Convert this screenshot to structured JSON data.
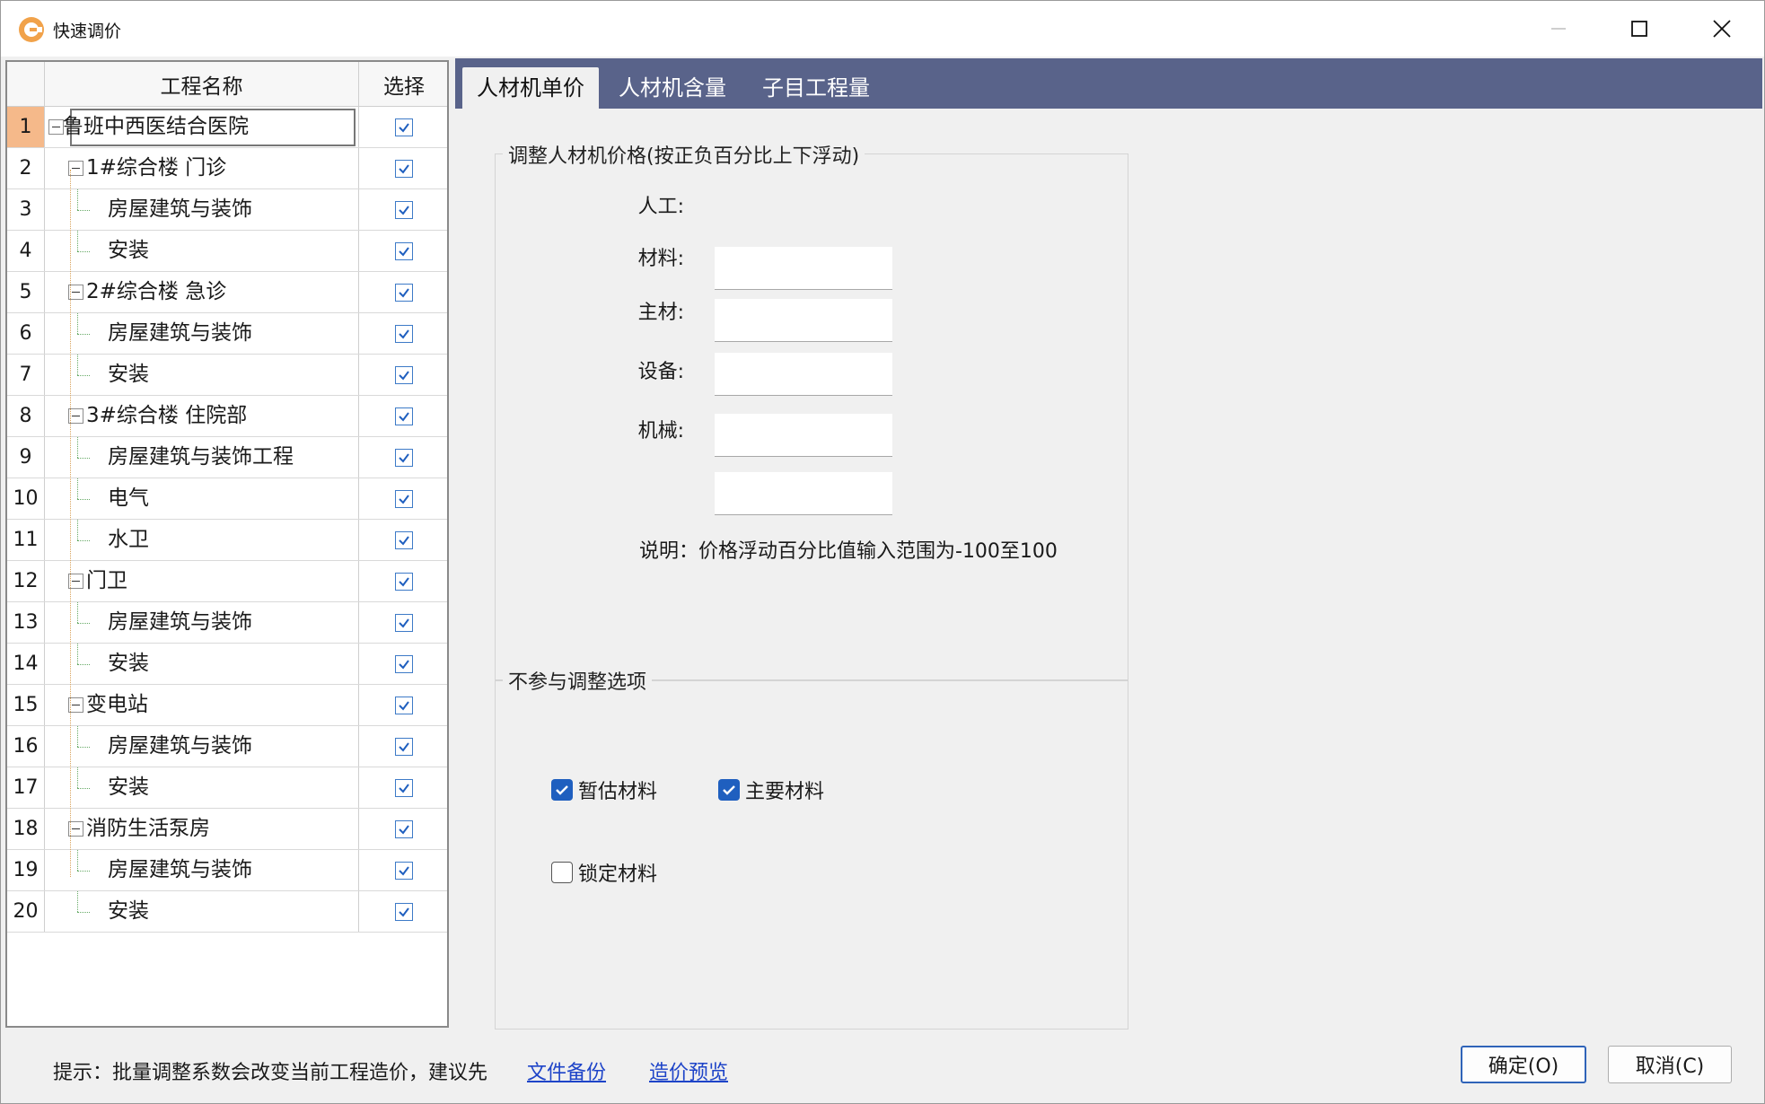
{
  "window": {
    "title": "快速调价"
  },
  "tree": {
    "headers": {
      "name": "工程名称",
      "select": "选择"
    },
    "rows": [
      {
        "num": "1",
        "label": "鲁班中西医结合医院",
        "level": 0,
        "checked": true
      },
      {
        "num": "2",
        "label": "1#综合楼 门诊",
        "level": 1,
        "checked": true
      },
      {
        "num": "3",
        "label": "房屋建筑与装饰",
        "level": 2,
        "checked": true
      },
      {
        "num": "4",
        "label": "安装",
        "level": 2,
        "checked": true
      },
      {
        "num": "5",
        "label": "2#综合楼 急诊",
        "level": 1,
        "checked": true
      },
      {
        "num": "6",
        "label": "房屋建筑与装饰",
        "level": 2,
        "checked": true
      },
      {
        "num": "7",
        "label": "安装",
        "level": 2,
        "checked": true
      },
      {
        "num": "8",
        "label": "3#综合楼 住院部",
        "level": 1,
        "checked": true
      },
      {
        "num": "9",
        "label": "房屋建筑与装饰工程",
        "level": 2,
        "checked": true
      },
      {
        "num": "10",
        "label": "电气",
        "level": 2,
        "checked": true
      },
      {
        "num": "11",
        "label": "水卫",
        "level": 2,
        "checked": true
      },
      {
        "num": "12",
        "label": "门卫",
        "level": 1,
        "checked": true
      },
      {
        "num": "13",
        "label": "房屋建筑与装饰",
        "level": 2,
        "checked": true
      },
      {
        "num": "14",
        "label": "安装",
        "level": 2,
        "checked": true
      },
      {
        "num": "15",
        "label": "变电站",
        "level": 1,
        "checked": true
      },
      {
        "num": "16",
        "label": "房屋建筑与装饰",
        "level": 2,
        "checked": true
      },
      {
        "num": "17",
        "label": "安装",
        "level": 2,
        "checked": true
      },
      {
        "num": "18",
        "label": "消防生活泵房",
        "level": 1,
        "checked": true
      },
      {
        "num": "19",
        "label": "房屋建筑与装饰",
        "level": 2,
        "checked": true
      },
      {
        "num": "20",
        "label": "安装",
        "level": 2,
        "checked": true
      }
    ]
  },
  "tabs": [
    {
      "label": "人材机单价",
      "active": true
    },
    {
      "label": "人材机含量",
      "active": false
    },
    {
      "label": "子目工程量",
      "active": false
    }
  ],
  "price_group": {
    "legend": "调整人材机价格(按正负百分比上下浮动)",
    "fields": [
      {
        "label": "人工:",
        "value": ""
      },
      {
        "label": "材料:",
        "value": ""
      },
      {
        "label": "主材:",
        "value": ""
      },
      {
        "label": "设备:",
        "value": ""
      },
      {
        "label": "机械:",
        "value": ""
      }
    ],
    "note": "说明：价格浮动百分比值输入范围为-100至100"
  },
  "exclude_group": {
    "legend": "不参与调整选项",
    "options": [
      {
        "label": "暂估材料",
        "checked": true
      },
      {
        "label": "主要材料",
        "checked": true
      },
      {
        "label": "锁定材料",
        "checked": false
      }
    ]
  },
  "footer": {
    "hint": "提示：批量调整系数会改变当前工程造价，建议先",
    "backup_link": "文件备份",
    "preview_link": "造价预览",
    "ok_label": "确定(O)",
    "cancel_label": "取消(C)"
  },
  "colors": {
    "tab_strip": "#59638a",
    "active_row_number": "#f5b98a",
    "checkbox_checked": "#1f5fbf",
    "link": "#1e44c8"
  }
}
